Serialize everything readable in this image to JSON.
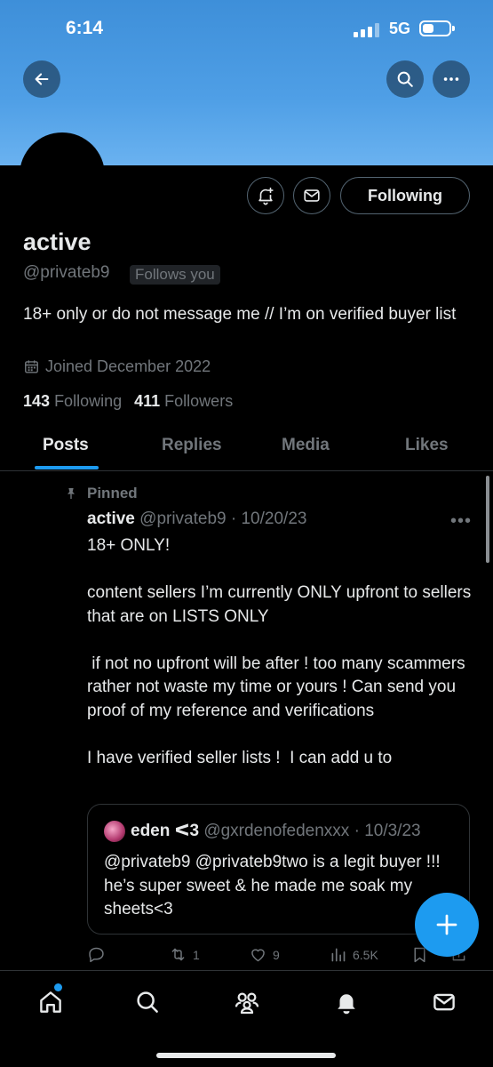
{
  "status_bar": {
    "time": "6:14",
    "network": "5G"
  },
  "profile": {
    "name": "active",
    "handle": "@privateb9",
    "follows_you": "Follows you",
    "bio": "18+ only or do not message me // I’m on verified buyer list",
    "joined": "Joined December 2022",
    "following_count": "143",
    "following_label": "Following",
    "followers_count": "411",
    "followers_label": "Followers",
    "following_button": "Following"
  },
  "tabs": [
    {
      "label": "Posts",
      "active": true
    },
    {
      "label": "Replies"
    },
    {
      "label": "Media"
    },
    {
      "label": "Likes"
    }
  ],
  "tweet": {
    "pinned_label": "Pinned",
    "name": "active",
    "handle_date": "@privateb9 · 10/20/23",
    "body": "18+ ONLY!\n\ncontent sellers I’m currently ONLY upfront to sellers that are on LISTS ONLY\n\n if not no upfront will be after ! too many scammers rather not waste my time or yours ! Can send you proof of my reference and verifications\n\nI have verified seller lists !  I can add u to",
    "quote": {
      "name": "eden ᐸ3",
      "handle_date": "@gxrdenofedenxxx · 10/3/23",
      "body": "@privateb9 @privateb9two  is a legit buyer !!!  he’s super sweet & he made me soak my sheets<3"
    },
    "replies": "",
    "retweets": "1",
    "likes": "9",
    "views": "6.5K"
  },
  "colors": {
    "accent": "#1d9bf0",
    "background": "#000000",
    "muted": "#71767b",
    "banner": "#4f9fe6"
  },
  "icons": [
    "back-arrow-icon",
    "search-icon",
    "more-icon",
    "notification-bell-plus-icon",
    "mail-icon",
    "calendar-icon",
    "pin-icon",
    "reply-icon",
    "retweet-icon",
    "like-icon",
    "views-icon",
    "bookmark-icon",
    "share-icon",
    "compose-plus-icon",
    "home-icon",
    "explore-icon",
    "communities-icon",
    "notifications-icon",
    "messages-icon"
  ]
}
